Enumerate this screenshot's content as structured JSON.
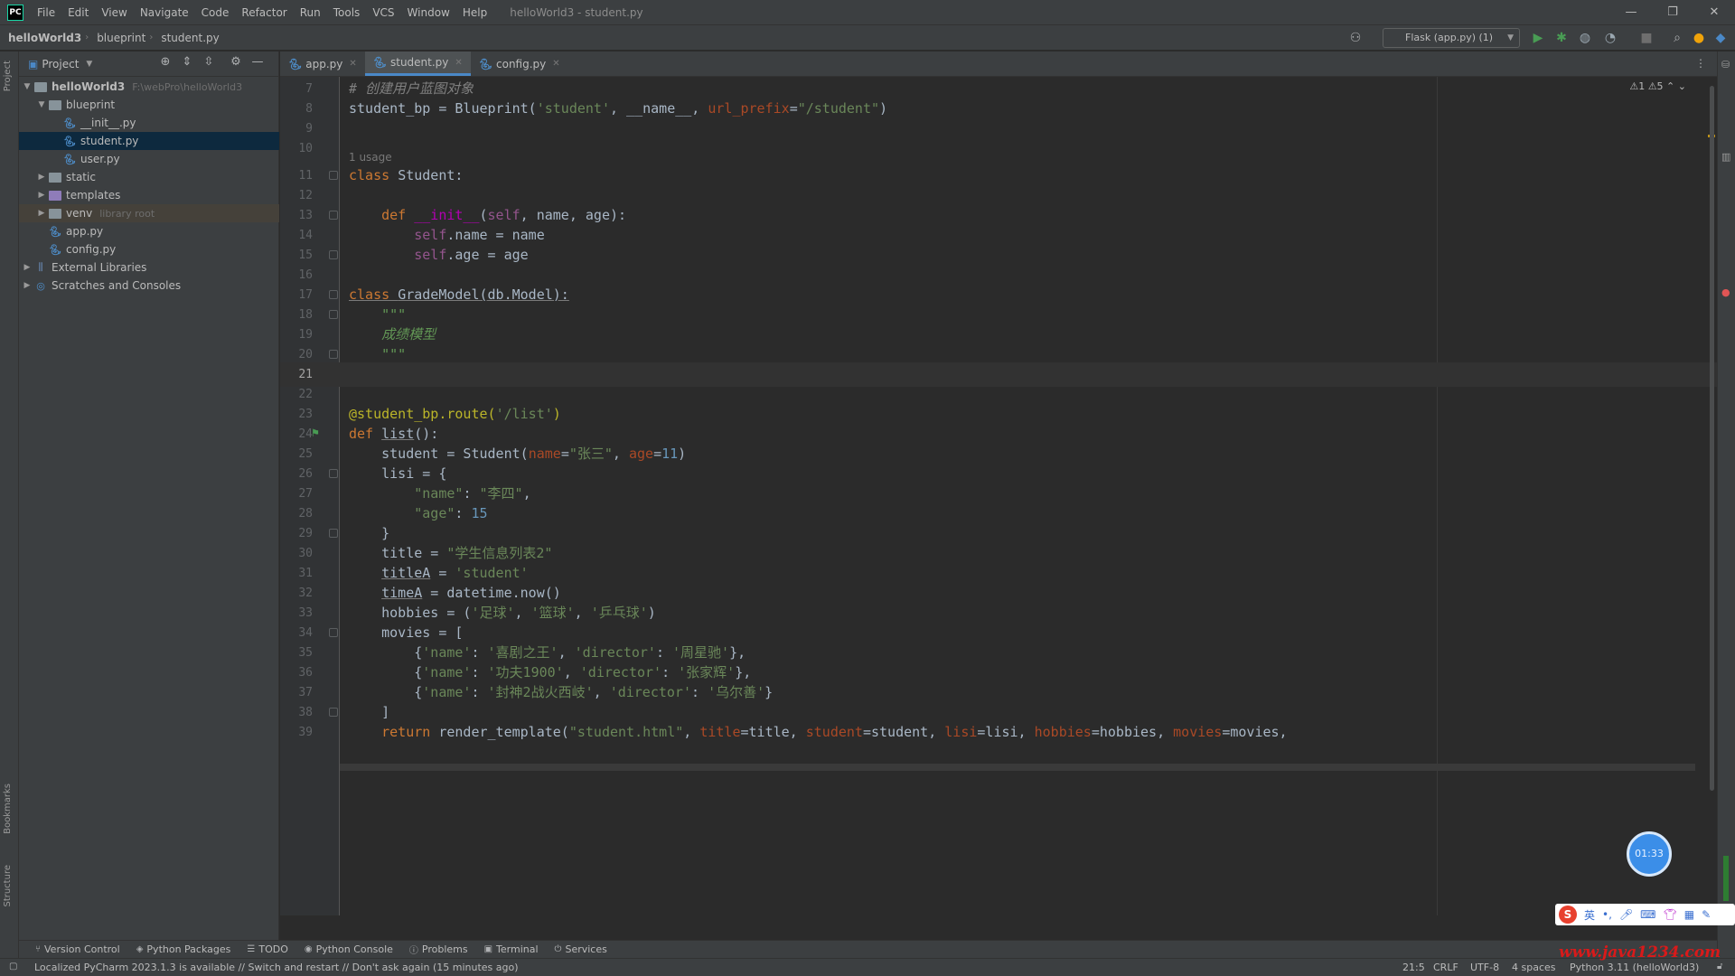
{
  "titlebar": {
    "menu": [
      "File",
      "Edit",
      "View",
      "Navigate",
      "Code",
      "Refactor",
      "Run",
      "Tools",
      "VCS",
      "Window",
      "Help"
    ],
    "title": "helloWorld3 - student.py",
    "minimize": "—",
    "restore": "❐",
    "close": "✕"
  },
  "navbar": {
    "crumbs": [
      "helloWorld3",
      "blueprint",
      "student.py"
    ],
    "run_config": "Flask (app.py) (1)"
  },
  "left_stripe": {
    "project": "Project",
    "bookmarks": "Bookmarks",
    "structure": "Structure"
  },
  "project_panel": {
    "header": "Project",
    "tree": [
      {
        "label": "helloWorld3",
        "path": "F:\\webPro\\helloWorld3",
        "icon": "folder-icon"
      },
      {
        "label": "blueprint",
        "icon": "folder-icon"
      },
      {
        "label": "__init__.py",
        "icon": "python-file-icon"
      },
      {
        "label": "student.py",
        "icon": "python-file-icon"
      },
      {
        "label": "user.py",
        "icon": "python-file-icon"
      },
      {
        "label": "static",
        "icon": "folder-icon"
      },
      {
        "label": "templates",
        "icon": "folder-icon"
      },
      {
        "label": "venv",
        "path": "library root",
        "icon": "folder-icon"
      },
      {
        "label": "app.py",
        "icon": "python-file-icon"
      },
      {
        "label": "config.py",
        "icon": "python-file-icon"
      },
      {
        "label": "External Libraries",
        "icon": "library-icon"
      },
      {
        "label": "Scratches and Consoles",
        "icon": "scratches-icon"
      }
    ]
  },
  "tabs": [
    {
      "label": "app.py"
    },
    {
      "label": "student.py"
    },
    {
      "label": "config.py"
    }
  ],
  "editor": {
    "inspections": "⚠1 ⚠5 ⌃ ⌄",
    "usage_hint": "1 usage",
    "line_numbers": [
      "7",
      "8",
      "9",
      "10",
      "11",
      "12",
      "13",
      "14",
      "15",
      "16",
      "17",
      "18",
      "19",
      "20",
      "21",
      "22",
      "23",
      "24",
      "25",
      "26",
      "27",
      "28",
      "29",
      "30",
      "31",
      "32",
      "33",
      "34",
      "35",
      "36",
      "37",
      "38",
      "39"
    ]
  },
  "bottom_tools": [
    "Version Control",
    "Python Packages",
    "TODO",
    "Python Console",
    "Problems",
    "Terminal",
    "Services"
  ],
  "statusbar": {
    "message": "Localized PyCharm 2023.1.3 is available // Switch and restart // Don't ask again (15 minutes ago)",
    "position": "21:5",
    "line_sep": "CRLF",
    "encoding": "UTF-8",
    "indent": "4 spaces",
    "interpreter": "Python 3.11 (helloWorld3)"
  },
  "overlays": {
    "timer": "01:33",
    "watermark": "www.java1234.com",
    "ime_logo": "S",
    "ime_lang": "英"
  },
  "colors": {
    "keyword": "#cc7832",
    "string": "#6a8759",
    "number": "#6897bb",
    "self": "#94558d",
    "decorator": "#bbb529",
    "background": "#2b2b2b"
  }
}
